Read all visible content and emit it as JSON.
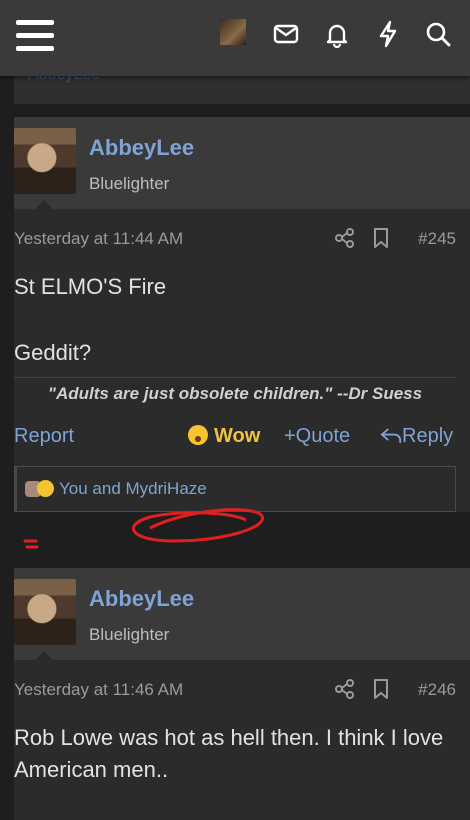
{
  "topbar": {
    "menu_icon": "hamburger-menu-icon",
    "icons": [
      "avatar",
      "mail-icon",
      "bell-icon",
      "lightning-icon",
      "search-icon"
    ]
  },
  "prev_post": {
    "tail_text": "AbbeyLee"
  },
  "posts": [
    {
      "username": "AbbeyLee",
      "user_title": "Bluelighter",
      "date": "Yesterday at 11:44 AM",
      "number": "#245",
      "body": [
        "St ELMO'S Fire",
        "Geddit?"
      ],
      "signature": "\"Adults are just obsolete children.\" --Dr Suess",
      "actions": {
        "report": "Report",
        "wow": "Wow",
        "quote": "+Quote",
        "reply": "Reply"
      },
      "reactions_text": "You and MydriHaze"
    },
    {
      "username": "AbbeyLee",
      "user_title": "Bluelighter",
      "date": "Yesterday at 11:46 AM",
      "number": "#246",
      "body": [
        "Rob Lowe was hot as hell then. I think I love American men.."
      ]
    }
  ],
  "colors": {
    "accent": "#7fa3d4",
    "wow": "#f0c040",
    "annotation": "#e02020"
  }
}
